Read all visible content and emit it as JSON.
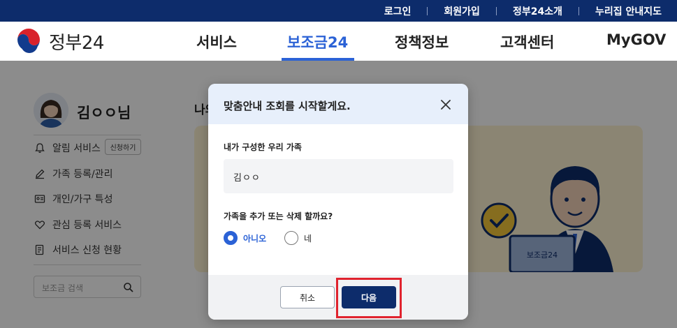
{
  "topbar": {
    "links": [
      "로그인",
      "회원가입",
      "정부24소개",
      "누리집 안내지도"
    ]
  },
  "header": {
    "logo_text": "정부24",
    "nav": [
      "서비스",
      "보조금24",
      "정책정보",
      "고객센터",
      "MyGOV"
    ],
    "active_nav": "보조금24"
  },
  "profile": {
    "name": "김ㅇㅇ님"
  },
  "side_menu": {
    "items": [
      {
        "label": "알림 서비스",
        "icon": "bell-icon"
      },
      {
        "label": "가족 등록/관리",
        "icon": "pencil-icon"
      },
      {
        "label": "개인/가구 특성",
        "icon": "id-card-icon"
      },
      {
        "label": "관심 등록 서비스",
        "icon": "heart-icon"
      },
      {
        "label": "서비스 신청 현황",
        "icon": "document-icon"
      }
    ],
    "apply_chip": "신청하기",
    "search_placeholder": "보조금 검색"
  },
  "content": {
    "title_partial": "나의",
    "banner_laptop_text": "보조금24"
  },
  "modal": {
    "title": "맞춤안내 조회를 시작할게요.",
    "family_label": "내가 구성한 우리 가족",
    "family_value": "김ㅇㅇ",
    "question": "가족을 추가 또는 삭제 할까요?",
    "options": [
      "아니오",
      "네"
    ],
    "selected": "아니오",
    "cancel_label": "취소",
    "next_label": "다음"
  },
  "colors": {
    "brand_navy": "#0d2c6b",
    "accent_blue": "#2b62d6",
    "highlight_red": "#e0232e",
    "banner_bg": "#fdf2d2"
  }
}
